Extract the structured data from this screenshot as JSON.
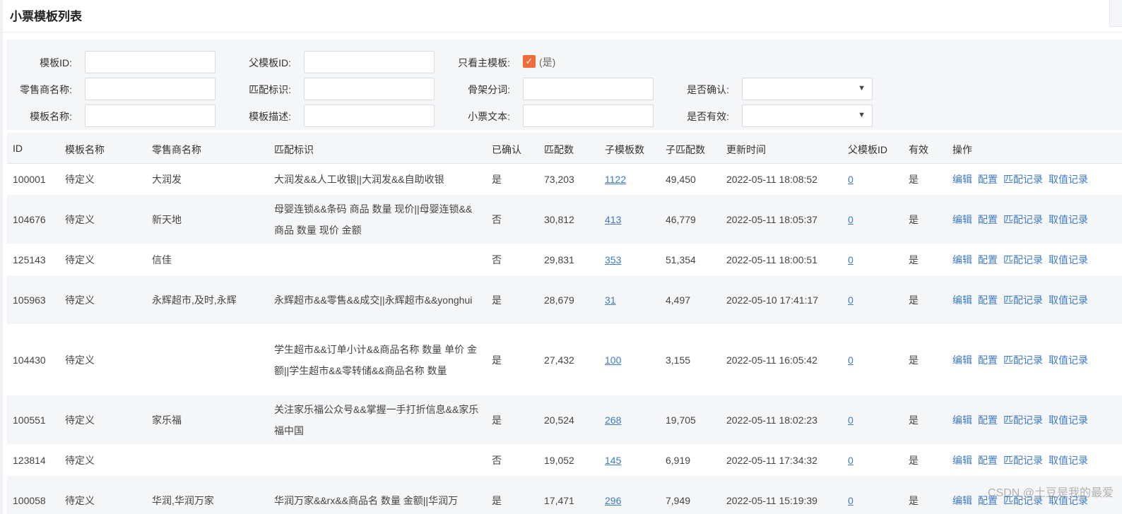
{
  "page": {
    "title": "小票模板列表"
  },
  "filters": {
    "template_id": {
      "label": "模板ID:",
      "value": ""
    },
    "parent_template_id": {
      "label": "父模板ID:",
      "value": ""
    },
    "only_main": {
      "label": "只看主模板:",
      "checked": true,
      "text": "(是)"
    },
    "retailer_name": {
      "label": "零售商名称:",
      "value": ""
    },
    "match_flag": {
      "label": "匹配标识:",
      "value": ""
    },
    "skeleton_words": {
      "label": "骨架分词:",
      "value": ""
    },
    "confirmed": {
      "label": "是否确认:",
      "value": ""
    },
    "template_name": {
      "label": "模板名称:",
      "value": ""
    },
    "template_desc": {
      "label": "模板描述:",
      "value": ""
    },
    "receipt_text": {
      "label": "小票文本:",
      "value": ""
    },
    "valid": {
      "label": "是否有效:",
      "value": ""
    }
  },
  "table": {
    "headers": [
      "ID",
      "模板名称",
      "零售商名称",
      "匹配标识",
      "已确认",
      "匹配数",
      "子模板数",
      "子匹配数",
      "更新时间",
      "父模板ID",
      "有效",
      "操作"
    ],
    "actions": [
      "编辑",
      "配置",
      "匹配记录",
      "取值记录"
    ],
    "rows": [
      {
        "id": "100001",
        "name": "待定义",
        "retailer": "大润发",
        "match": "大润发&&人工收银||大润发&&自助收银",
        "confirmed": "是",
        "match_count": "73,203",
        "child_count": "1122",
        "child_match": "49,450",
        "updated": "2022-05-11 18:08:52",
        "parent_id": "0",
        "valid": "是"
      },
      {
        "id": "104676",
        "name": "待定义",
        "retailer": "新天地",
        "match": "母婴连锁&&条码 商品 数量 现价||母婴连锁&&商品 数量 现价 金额",
        "confirmed": "否",
        "match_count": "30,812",
        "child_count": "413",
        "child_match": "46,779",
        "updated": "2022-05-11 18:05:37",
        "parent_id": "0",
        "valid": "是"
      },
      {
        "id": "125143",
        "name": "待定义",
        "retailer": "信佳",
        "match": "",
        "confirmed": "否",
        "match_count": "29,831",
        "child_count": "353",
        "child_match": "51,354",
        "updated": "2022-05-11 18:00:51",
        "parent_id": "0",
        "valid": "是"
      },
      {
        "id": "105963",
        "name": "待定义",
        "retailer": "永辉超市,及时,永辉",
        "match": "永辉超市&&零售&&成交||永辉超市&&yonghui",
        "confirmed": "是",
        "match_count": "28,679",
        "child_count": "31",
        "child_match": "4,497",
        "updated": "2022-05-10 17:41:17",
        "parent_id": "0",
        "valid": "是"
      },
      {
        "id": "104430",
        "name": "待定义",
        "retailer": "",
        "match": "学生超市&&订单小计&&商品名称 数量 单价 金额||学生超市&&零转储&&商品名称 数量",
        "confirmed": "是",
        "match_count": "27,432",
        "child_count": "100",
        "child_match": "3,155",
        "updated": "2022-05-11 16:05:42",
        "parent_id": "0",
        "valid": "是"
      },
      {
        "id": "100551",
        "name": "待定义",
        "retailer": "家乐福",
        "match": "关注家乐福公众号&&掌握一手打折信息&&家乐福中国",
        "confirmed": "是",
        "match_count": "20,524",
        "child_count": "268",
        "child_match": "19,705",
        "updated": "2022-05-11 18:02:23",
        "parent_id": "0",
        "valid": "是"
      },
      {
        "id": "123814",
        "name": "待定义",
        "retailer": "",
        "match": "",
        "confirmed": "否",
        "match_count": "19,052",
        "child_count": "145",
        "child_match": "6,919",
        "updated": "2022-05-11 17:34:32",
        "parent_id": "0",
        "valid": "是"
      },
      {
        "id": "100058",
        "name": "待定义",
        "retailer": "华润,华润万家",
        "match": "华润万家&&rx&&商品名 数量 金额||华润万",
        "confirmed": "是",
        "match_count": "17,471",
        "child_count": "296",
        "child_match": "7,949",
        "updated": "2022-05-11 15:19:39",
        "parent_id": "0",
        "valid": "是"
      }
    ]
  },
  "watermark": "CSDN @土豆是我的最爱"
}
